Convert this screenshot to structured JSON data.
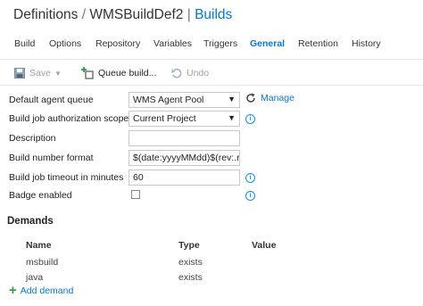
{
  "header": {
    "definitions": "Definitions",
    "separator": "/",
    "definition_name": "WMSBuildDef2",
    "pipe": "|",
    "builds_link": "Builds"
  },
  "tabs": [
    {
      "label": "Build"
    },
    {
      "label": "Options"
    },
    {
      "label": "Repository"
    },
    {
      "label": "Variables"
    },
    {
      "label": "Triggers"
    },
    {
      "label": "General",
      "active": true
    },
    {
      "label": "Retention"
    },
    {
      "label": "History"
    }
  ],
  "toolbar": {
    "save_label": "Save",
    "queue_label": "Queue build...",
    "undo_label": "Undo"
  },
  "form": {
    "agent_queue_label": "Default agent queue",
    "agent_queue_value": "WMS Agent Pool",
    "manage_label": "Manage",
    "auth_scope_label": "Build job authorization scope",
    "auth_scope_value": "Current Project",
    "description_label": "Description",
    "description_value": "",
    "number_format_label": "Build number format",
    "number_format_value": "$(date:yyyyMMdd)$(rev:.r)",
    "timeout_label": "Build job timeout in minutes",
    "timeout_value": "60",
    "badge_label": "Badge enabled",
    "badge_checked": false
  },
  "demands": {
    "title": "Demands",
    "columns": [
      "Name",
      "Type",
      "Value"
    ],
    "rows": [
      {
        "name": "msbuild",
        "type": "exists",
        "value": ""
      },
      {
        "name": "java",
        "type": "exists",
        "value": ""
      }
    ],
    "add_label": "Add demand"
  },
  "colors": {
    "accent": "#0078d7",
    "add_icon": "#2e9c3c",
    "disabled": "#a0a0a0"
  }
}
